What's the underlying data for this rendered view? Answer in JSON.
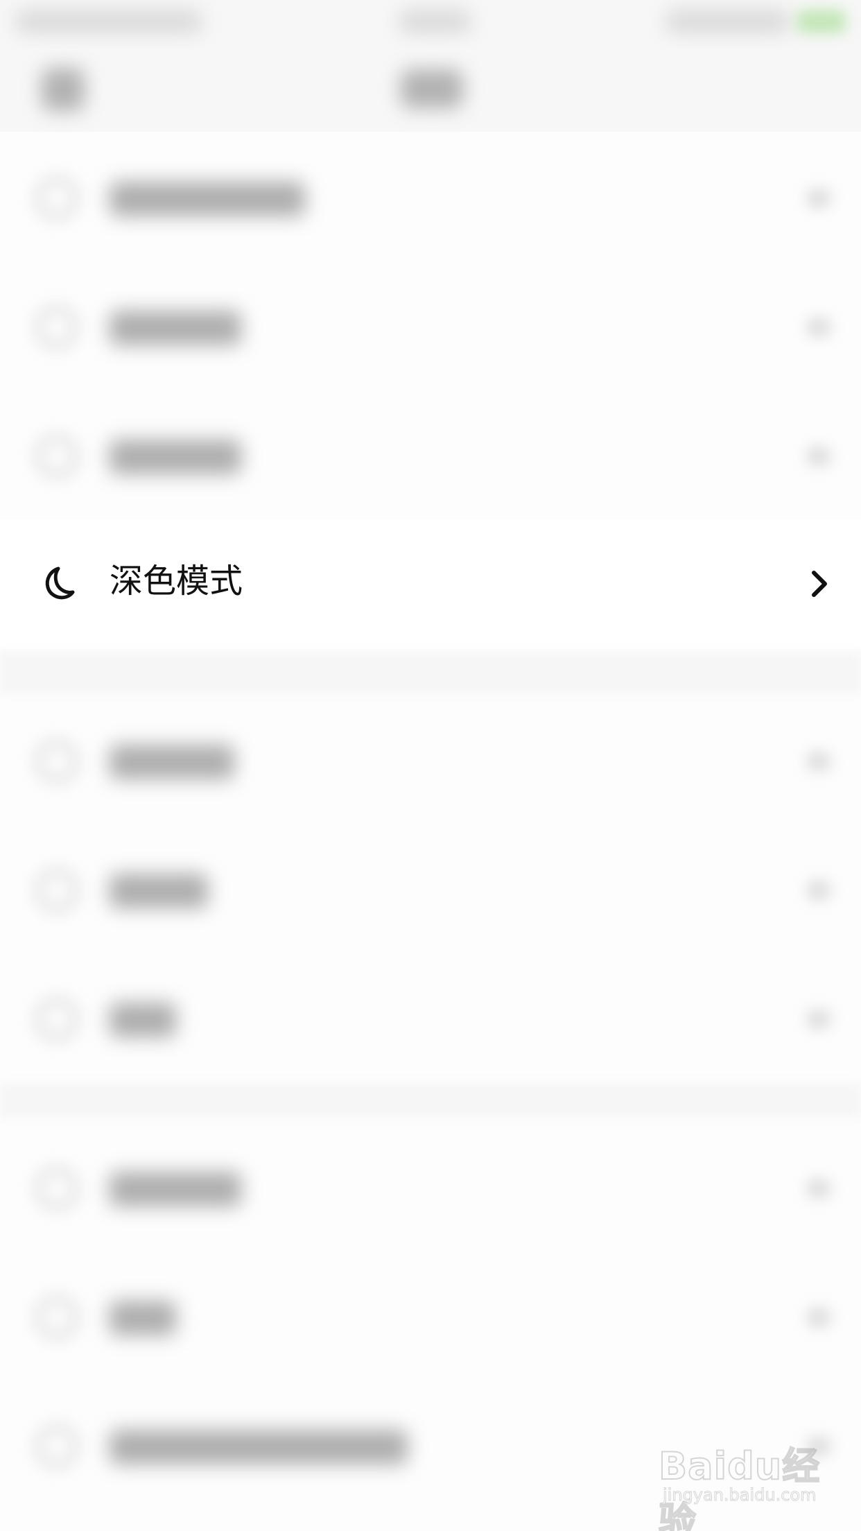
{
  "settings": {
    "dark_mode_item": {
      "label": "深色模式",
      "icon": "moon-icon",
      "trailing_icon": "chevron-right-icon"
    }
  },
  "watermark": {
    "brand": "Baidu经验",
    "url": "jingyan.baidu.com"
  },
  "colors": {
    "text": "#111111",
    "background": "#ffffff",
    "status_accent": "#9fdc8c"
  }
}
